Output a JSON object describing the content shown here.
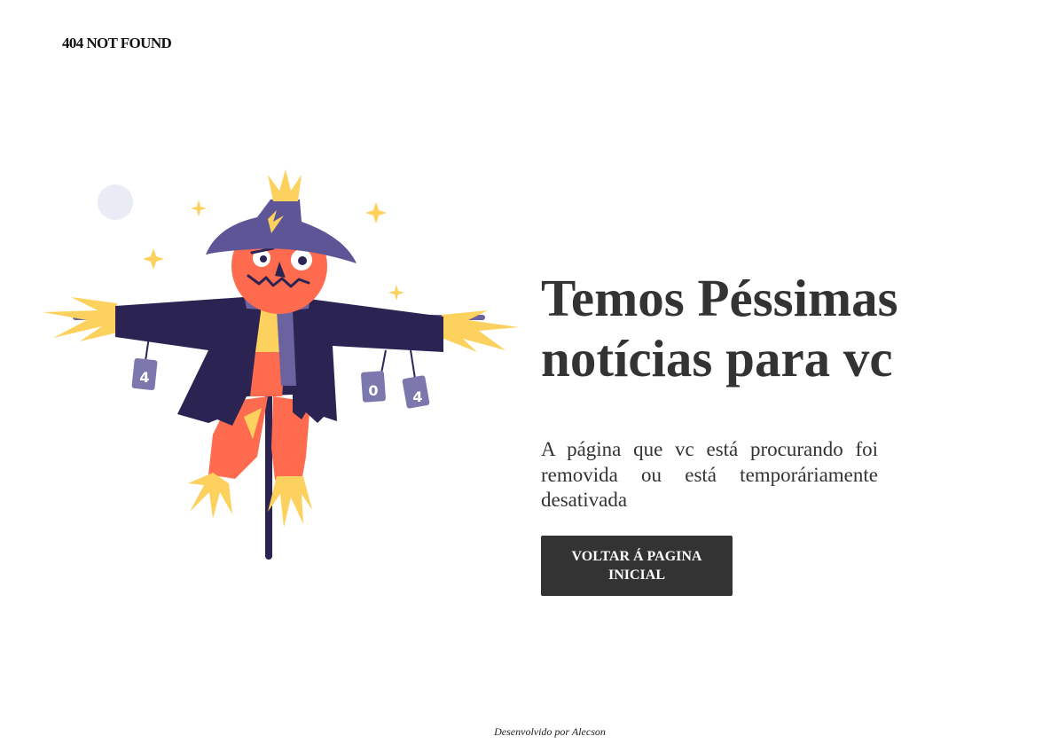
{
  "header": {
    "logo_text": "404 NOT FOUND"
  },
  "main": {
    "headline": "Temos Péssimas notícias para vc",
    "message": "A página que vc está procurando foi removida ou está temporáriamente desativada",
    "button_label": "VOLTAR Á PAGINA INICIAL"
  },
  "illustration": {
    "subject": "scarecrow",
    "can_labels": [
      "4",
      "0",
      "4"
    ]
  },
  "footer": {
    "credit": "Desenvolvido por Alecson"
  },
  "colors": {
    "text": "#333333",
    "button_bg": "#333333",
    "button_text": "#ffffff",
    "hat": "#5e5597",
    "coat": "#2b2452",
    "face": "#ff6b4f",
    "straw": "#fdd15e",
    "scarf": "#6a639f",
    "can": "#7c77ad",
    "moon": "#e9ebf5"
  }
}
